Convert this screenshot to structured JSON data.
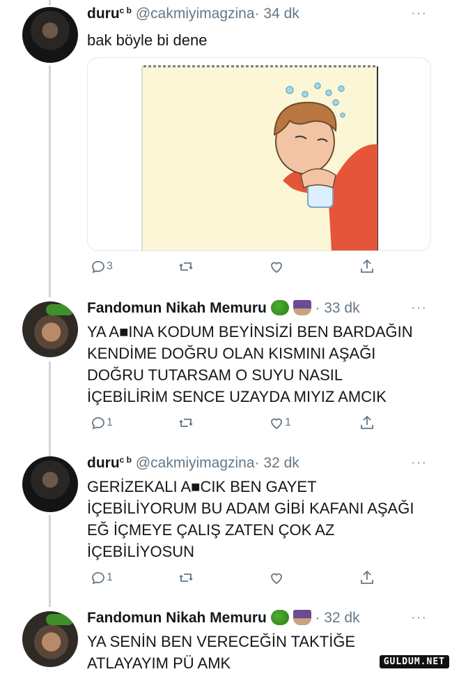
{
  "tweets": [
    {
      "author": "duru",
      "badge": "c b",
      "handle": "@cakmiyimagzina",
      "separator": "·",
      "time": "34 dk",
      "text": "bak böyle bi dene",
      "actions": {
        "reply": "3",
        "retweet": "",
        "like": ""
      }
    },
    {
      "author": "Fandomun Nikah Memuru",
      "separator": "·",
      "time": "33 dk",
      "text": [
        "YA A■INA KODUM BEYİNSİZİ BEN BARDAĞIN",
        "KENDİME DOĞRU OLAN KISMINI AŞAĞI",
        "DOĞRU TUTARSAM O SUYU NASIL",
        "İÇEBİLİRİM SENCE UZAYDA MIYIZ AMCIK"
      ],
      "actions": {
        "reply": "1",
        "retweet": "",
        "like": "1"
      }
    },
    {
      "author": "duru",
      "badge": "c b",
      "handle": "@cakmiyimagzina",
      "separator": "·",
      "time": "32 dk",
      "text": [
        "GERİZEKALI A■CIK BEN GAYET",
        "İÇEBİLİYORUM BU ADAM GİBİ KAFANI AŞAĞI",
        "EĞ İÇMEYE ÇALIŞ ZATEN ÇOK AZ",
        "İÇEBİLİYOSUN"
      ],
      "actions": {
        "reply": "1",
        "retweet": "",
        "like": ""
      }
    },
    {
      "author": "Fandomun Nikah Memuru",
      "separator": "·",
      "time": "32 dk",
      "text": [
        "YA SENİN BEN VERECEĞİN TAKTİĞE",
        "ATLAYAYIM PÜ AMK"
      ]
    }
  ],
  "more_label": "···",
  "watermark": "GULDUM.NET",
  "icons": [
    "reply-icon",
    "retweet-icon",
    "like-icon",
    "share-icon",
    "broccoli-emoji",
    "wizard-emoji"
  ],
  "colors": {
    "text": "#14171a",
    "muted": "#657786",
    "thread": "#ccd6dd",
    "shirt": "#e5553a",
    "bg_illustration": "#fbf6d5"
  }
}
